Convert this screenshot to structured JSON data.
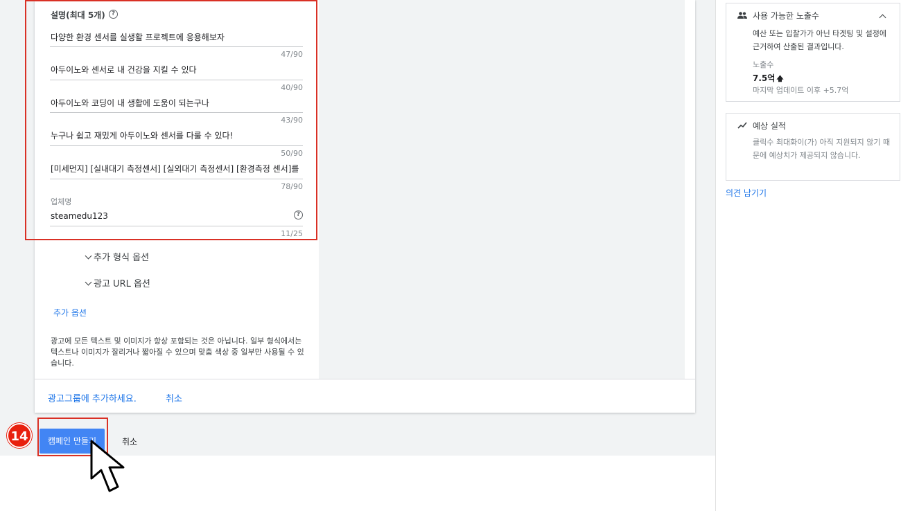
{
  "description_section": {
    "title": "설명(최대 5개)",
    "fields": [
      {
        "value": "다양한 환경 센서를 실생활 프로젝트에 응용해보자",
        "counter": "47/90"
      },
      {
        "value": "아두이노와 센서로 내 건강을 지킬 수 있다",
        "counter": "40/90"
      },
      {
        "value": "아두이노와 코딩이 내 생활에 도움이 되는구나",
        "counter": "43/90"
      },
      {
        "value": "누구나 쉽고 재밌게 아두이노와 센서를 다룰 수 있다!",
        "counter": "50/90"
      },
      {
        "value": "[미세먼지] [실내대기 측정센서] [실외대기 측정센서] [환경측정 센서]를",
        "counter": "78/90"
      }
    ],
    "business_name": {
      "label": "업체명",
      "value": "steamedu123",
      "counter": "11/25"
    }
  },
  "options": {
    "extra_format": "추가 형식 옵션",
    "ad_url": "광고 URL 옵션",
    "more": "추가 옵션"
  },
  "note": "광고에 모든 텍스트 및 이미지가 항상 포함되는 것은 아닙니다. 일부 형식에서는 텍스트나 이미지가 잘리거나 짧아질 수 있으며 맞춤 색상 중 일부만 사용될 수 있습니다.",
  "card_footer": {
    "add_to_adgroup": "광고그룹에 추가하세요.",
    "cancel": "취소"
  },
  "actions": {
    "create_campaign": "캠페인 만들기",
    "cancel": "취소",
    "step_number": "14"
  },
  "right_panel": {
    "impressions": {
      "title": "사용 가능한 노출수",
      "description": "예산 또는 입찰가가 아닌 타겟팅 및 설정에 근거하여 산출된 결과입니다.",
      "metric_label": "노출수",
      "metric_value": "7.5억",
      "update_note": "마지막 업데이트 이후 +5.7억"
    },
    "performance": {
      "title": "예상 실적",
      "description": "클릭수 최대화이(가) 아직 지원되지 않기 때문에 예상치가 제공되지 않습니다."
    },
    "feedback_link": "의견 남기기"
  },
  "colors": {
    "accent": "#1a73e8",
    "highlight": "#d93025",
    "button": "#4285f4",
    "badge": "#e8200e"
  },
  "icons": [
    "help-icon",
    "chevron-down-icon",
    "people-icon",
    "chevron-up-icon",
    "trend-icon",
    "arrow-up-icon",
    "pointer-cursor-icon"
  ]
}
